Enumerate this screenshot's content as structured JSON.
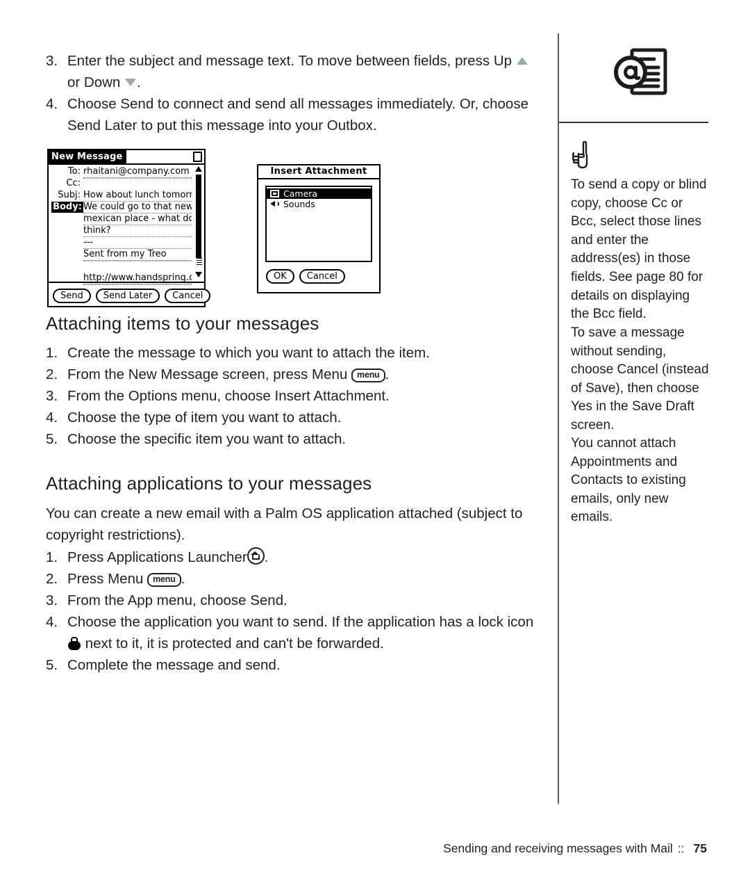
{
  "page": {
    "footer_text": "Sending and receiving messages with Mail",
    "footer_separator": "::",
    "page_number": "75"
  },
  "main": {
    "top_steps": [
      {
        "num": "3.",
        "text_before": "Enter the subject and message text. To move between fields, press Up",
        "text_after": "or Down",
        "text_end": "."
      },
      {
        "num": "4.",
        "text": "Choose Send to connect and send all messages immediately. Or, choose Send Later to put this message into your Outbox."
      }
    ],
    "section_1": {
      "heading": "Attaching items to your messages",
      "steps": [
        {
          "num": "1.",
          "text": "Create the message to which you want to attach the item."
        },
        {
          "num": "2.",
          "text_before": "From the New Message screen, press Menu",
          "key": "menu",
          "text_after": "."
        },
        {
          "num": "3.",
          "text": "From the Options menu, choose Insert Attachment."
        },
        {
          "num": "4.",
          "text": "Choose the type of item you want to attach."
        },
        {
          "num": "5.",
          "text": "Choose the specific item you want to attach."
        }
      ]
    },
    "section_2": {
      "heading": "Attaching applications to your messages",
      "intro": "You can create a new email with a Palm OS application attached (subject to copyright restrictions).",
      "steps": [
        {
          "num": "1.",
          "text_before": "Press Applications Launcher",
          "text_after": "."
        },
        {
          "num": "2.",
          "text_before": "Press Menu",
          "key": "menu",
          "text_after": "."
        },
        {
          "num": "3.",
          "text": "From the App menu, choose Send."
        },
        {
          "num": "4.",
          "text_before": "Choose the application you want to send. If the application has a lock icon",
          "text_after": "next to it, it is protected and can't be forwarded."
        },
        {
          "num": "5.",
          "text": "Complete the message and send."
        }
      ]
    }
  },
  "new_message_screen": {
    "title": "New Message",
    "fields": [
      {
        "label": "To:",
        "value": "rhaitani@company.com"
      },
      {
        "label": "Cc:",
        "value": ""
      },
      {
        "label": "Subj:",
        "value": "How about lunch tomorrow?"
      }
    ],
    "body_label": "Body:",
    "body_lines": [
      "We could go to that new",
      "mexican place - what do u",
      "think?",
      "---",
      "Sent from my Treo",
      "",
      "http://www.handspring.com"
    ],
    "buttons": [
      "Send",
      "Send Later",
      "Cancel"
    ]
  },
  "insert_attachment_screen": {
    "title": "Insert Attachment",
    "items": [
      {
        "label": "Camera",
        "icon": "camera-icon",
        "selected": true
      },
      {
        "label": "Sounds",
        "icon": "speaker-icon",
        "selected": false
      }
    ],
    "buttons": [
      "OK",
      "Cancel"
    ]
  },
  "sidebar": {
    "header_icon": "email-document-icon",
    "tip_icon": "pointing-hand-icon",
    "notes": [
      "To send a copy or blind copy, choose Cc or Bcc, select those lines and enter the address(es) in those fields. See page 80 for details on displaying the Bcc field.",
      "To save a message without sending, choose Cancel (instead of Save), then choose Yes in the Save Draft screen.",
      "You cannot attach Appointments and Contacts to existing emails, only new emails."
    ]
  },
  "colors": {
    "text": "#231f20",
    "triangle": "#9aabac",
    "rule": "#5a5a5a"
  }
}
